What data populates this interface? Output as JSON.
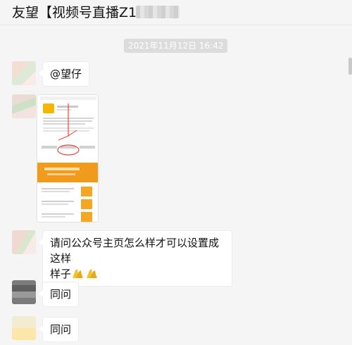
{
  "window": {
    "title": "友望【视频号直播Z1】"
  },
  "chat": {
    "timestamp": "2021年11月12日 16:42",
    "messages": [
      {
        "text": "@望仔"
      },
      {
        "text": "请问公众号主页怎么样才可以设置成这样"
      },
      {
        "text": "样子"
      },
      {
        "text": "同问"
      },
      {
        "text": "同问"
      }
    ]
  },
  "icons": [
    "praying-hands-emoji",
    "praying-hands-emoji"
  ]
}
